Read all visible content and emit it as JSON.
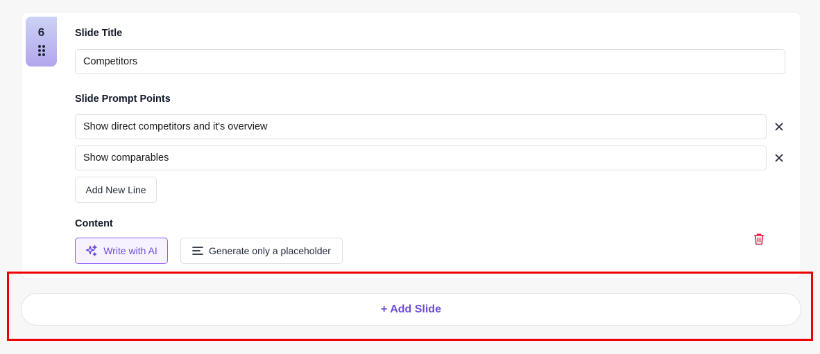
{
  "slide": {
    "number": "6",
    "title_label": "Slide Title",
    "title_value": "Competitors",
    "prompt_label": "Slide Prompt Points",
    "prompt_points": [
      "Show direct competitors and it's overview",
      "Show comparables"
    ],
    "add_line_label": "Add New Line",
    "content_label": "Content",
    "write_ai_label": "Write with AI",
    "placeholder_label": "Generate only a placeholder"
  },
  "add_slide_label": "+ Add Slide",
  "colors": {
    "accent": "#6d4bd8",
    "badge_top": "#ccd3f5",
    "badge_bottom": "#b2a6ec",
    "danger": "#e11d48",
    "highlight": "#ee0000"
  },
  "icons": {
    "drag": "drag-handle-icon",
    "remove": "close-icon",
    "ai": "sparkles-icon",
    "placeholder": "align-left-icon",
    "delete": "trash-icon"
  }
}
